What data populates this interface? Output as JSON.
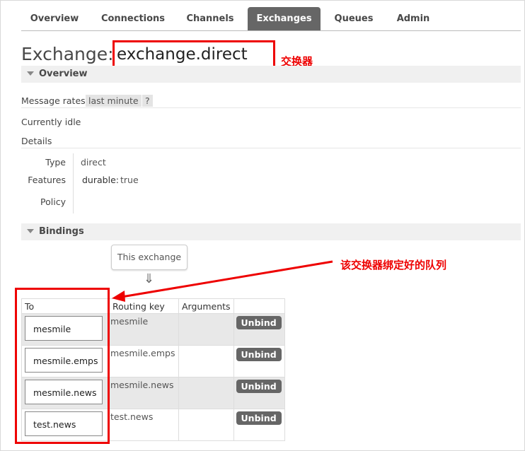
{
  "tabs": [
    {
      "label": "Overview",
      "active": false
    },
    {
      "label": "Connections",
      "active": false
    },
    {
      "label": "Channels",
      "active": false
    },
    {
      "label": "Exchanges",
      "active": true
    },
    {
      "label": "Queues",
      "active": false
    },
    {
      "label": "Admin",
      "active": false
    }
  ],
  "page": {
    "title_prefix": "Exchange:",
    "exchange_name": "exchange.direct"
  },
  "annotations": {
    "exchange": "交换器",
    "bindings": "该交换器绑定好的队列",
    "color": "#e00000"
  },
  "overview": {
    "section_label": "Overview",
    "message_rates_label": "Message rates",
    "message_rates_value": "last minute",
    "help": "?",
    "status": "Currently idle",
    "details_label": "Details",
    "details": {
      "type_label": "Type",
      "type_value": "direct",
      "features_label": "Features",
      "features_key": "durable:",
      "features_value": "true",
      "policy_label": "Policy"
    }
  },
  "bindings": {
    "section_label": "Bindings",
    "this_exchange": "This exchange",
    "arrow": "⇓",
    "headers": {
      "to": "To",
      "routing_key": "Routing key",
      "arguments": "Arguments"
    },
    "rows": [
      {
        "to": "mesmile",
        "routing_key": "mesmile",
        "arguments": "",
        "action": "Unbind"
      },
      {
        "to": "mesmile.emps",
        "routing_key": "mesmile.emps",
        "arguments": "",
        "action": "Unbind"
      },
      {
        "to": "mesmile.news",
        "routing_key": "mesmile.news",
        "arguments": "",
        "action": "Unbind"
      },
      {
        "to": "test.news",
        "routing_key": "test.news",
        "arguments": "",
        "action": "Unbind"
      }
    ]
  }
}
